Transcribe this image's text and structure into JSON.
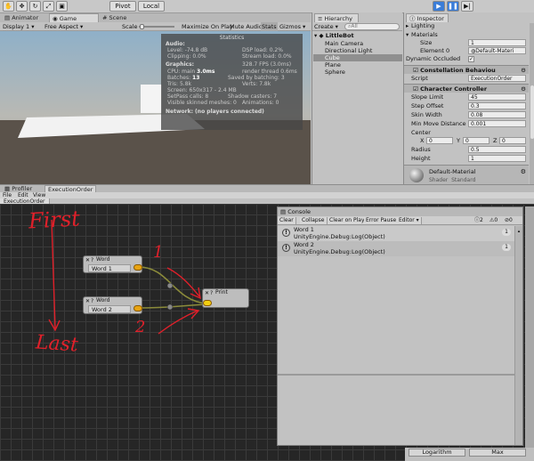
{
  "toolbar": {
    "pivot": "Pivot",
    "local": "Local"
  },
  "game_tabs": {
    "animator": "Animator",
    "game": "Game",
    "scene": "Scene"
  },
  "game_bar": {
    "display": "Display 1",
    "aspect": "Free Aspect",
    "scale": "Scale",
    "maximize": "Maximize On Play",
    "mute": "Mute Audio",
    "stats": "Stats",
    "gizmos": "Gizmos"
  },
  "statistics": {
    "title": "Statistics",
    "audio_header": "Audio:",
    "level": "Level: -74.8 dB",
    "clipping": "Clipping: 0.0%",
    "dsp": "DSP load: 0.2%",
    "stream": "Stream load: 0.0%",
    "graphics_header": "Graphics:",
    "fps": "328.7 FPS (3.0ms)",
    "cpu_label": "CPU: main",
    "cpu_value": "3.0ms",
    "render_thread": "render thread 0.6ms",
    "batches_label": "Batches:",
    "batches_value": "13",
    "saved_batching": "Saved by batching: 3",
    "tris": "Tris: 5.8k",
    "verts": "Verts: 7.8k",
    "screen": "Screen: 650x317 - 2.4 MB",
    "setpass": "SetPass calls: 8",
    "shadow_casters": "Shadow casters: 7",
    "skinned": "Visible skinned meshes: 0",
    "animations": "Animations: 0",
    "network": "Network: (no players connected)"
  },
  "hierarchy": {
    "title": "Hierarchy",
    "create": "Create",
    "search_placeholder": "All",
    "scene_name": "LittleBot",
    "items": [
      "Main Camera",
      "Directional Light",
      "Cube",
      "Plane",
      "Sphere"
    ]
  },
  "inspector": {
    "title": "Inspector",
    "lighting": "Lighting",
    "materials": "Materials",
    "size_label": "Size",
    "size_value": "1",
    "element0_label": "Element 0",
    "element0_value": "Default-Materi",
    "dynamic_occluded": "Dynamic Occluded",
    "constellation": "Constellation Behaviou",
    "script_label": "Script",
    "script_value": "ExecutionOrder",
    "char_controller": "Character Controller",
    "fields": [
      {
        "label": "Slope Limit",
        "value": "45"
      },
      {
        "label": "Step Offset",
        "value": "0.3"
      },
      {
        "label": "Skin Width",
        "value": "0.08"
      },
      {
        "label": "Min Move Distance",
        "value": "0.001"
      }
    ],
    "center_label": "Center",
    "center": {
      "x": "0",
      "y": "0",
      "z": "0"
    },
    "radius_label": "Radius",
    "radius_value": "0.5",
    "height_label": "Height",
    "height_value": "1",
    "material_name": "Default-Material",
    "shader_label": "Shader",
    "shader_value": "Standard",
    "logarithm": "Logarithm",
    "max": "Max"
  },
  "lower_tabs": {
    "profiler": "Profiler",
    "execution_order": "ExecutionOrder"
  },
  "graph_menu": [
    "File",
    "Edit",
    "View"
  ],
  "graph_tab": "ExecutionOrder",
  "nodes": {
    "word1_title": "Word",
    "word1_value": "Word 1",
    "word2_title": "Word",
    "word2_value": "Word 2",
    "print_title": "Print"
  },
  "annotations": {
    "first": "First",
    "last": "Last",
    "one": "1",
    "two": "2"
  },
  "console": {
    "title": "Console",
    "buttons": [
      "Clear",
      "Collapse",
      "Clear on Play",
      "Error Pause",
      "Editor"
    ],
    "count_info": "2",
    "count_warn": "0",
    "count_error": "0",
    "entries": [
      {
        "line1": "Word 1",
        "line2": "UnityEngine.Debug:Log(Object)",
        "count": "1"
      },
      {
        "line1": "Word 2",
        "line2": "UnityEngine.Debug:Log(Object)",
        "count": "1"
      }
    ]
  },
  "colors": {
    "accent": "#3a7dd8",
    "ink_red": "#e0202a",
    "port_orange": "#e8a412",
    "wire_olive": "#8b8b3a"
  }
}
